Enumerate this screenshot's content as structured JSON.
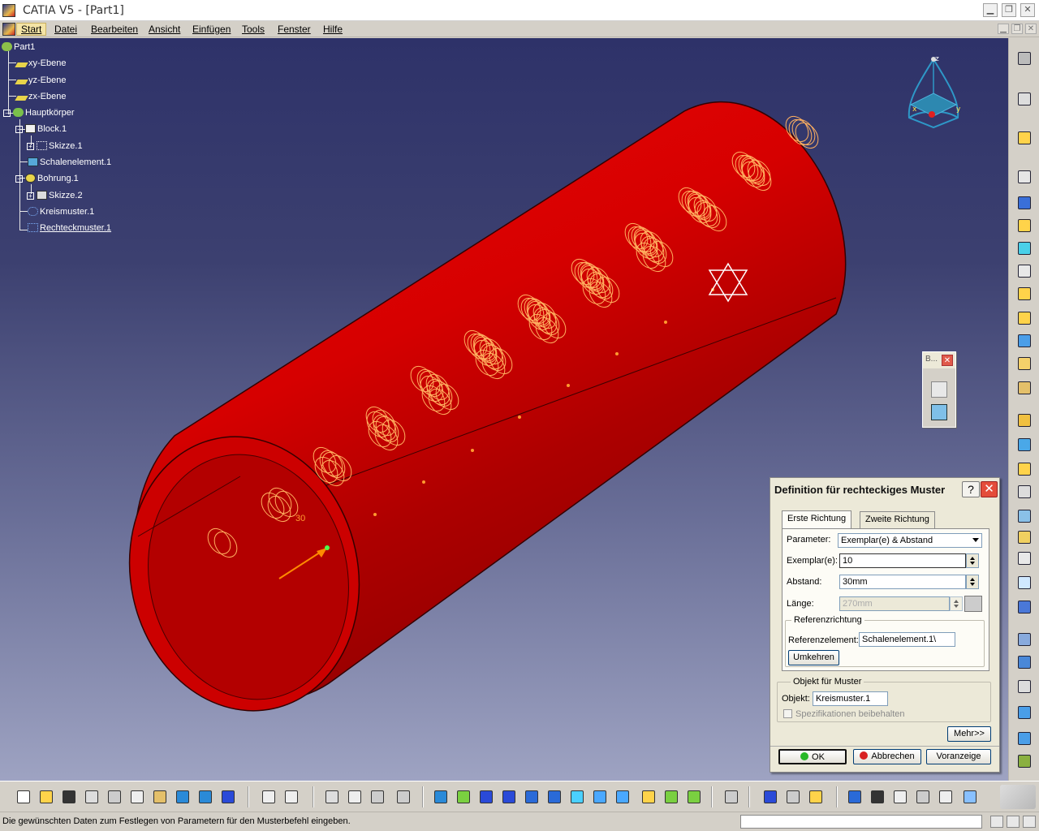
{
  "window": {
    "title": "CATIA V5 - [Part1]",
    "minimize_glyph": "▁",
    "restore_glyph": "❐",
    "close_glyph": "✕"
  },
  "menu": {
    "items": [
      "Start",
      "Datei",
      "Bearbeiten",
      "Ansicht",
      "Einfügen",
      "Tools",
      "Fenster",
      "Hilfe"
    ],
    "active": "Start"
  },
  "tree": {
    "root": "Part1",
    "items": [
      "xy-Ebene",
      "yz-Ebene",
      "zx-Ebene",
      "Hauptkörper",
      "Block.1",
      "Skizze.1",
      "Schalenelement.1",
      "Bohrung.1",
      "Skizze.2",
      "Kreismuster.1",
      "Rechteckmuster.1"
    ]
  },
  "viewport": {
    "compass_labels": {
      "z": "z",
      "x": "x",
      "y": "y"
    },
    "dimension_label": "30",
    "part_color": "#e00000"
  },
  "palette": {
    "title": "B...",
    "close_glyph": "✕"
  },
  "dialog": {
    "title": "Definition für rechteckiges Muster",
    "help_glyph": "?",
    "close_glyph": "✕",
    "tabs": [
      "Erste Richtung",
      "Zweite Richtung"
    ],
    "parameter_label": "Parameter:",
    "parameter_value": "Exemplar(e) & Abstand",
    "instances_label": "Exemplar(e):",
    "instances_value": "10",
    "spacing_label": "Abstand:",
    "spacing_value": "30mm",
    "length_label": "Länge:",
    "length_value": "270mm",
    "reference_group": "Referenzrichtung",
    "reference_label": "Referenzelement:",
    "reference_value": "Schalenelement.1\\",
    "reverse_button": "Umkehren",
    "object_group": "Objekt für Muster",
    "object_label": "Objekt:",
    "object_value": "Kreismuster.1",
    "keep_specs_label": "Spezifikationen beibehalten",
    "more_button": "Mehr>>",
    "ok_button": "OK",
    "cancel_button": "Abbrechen",
    "preview_button": "Voranzeige"
  },
  "status": {
    "message": "Die gewünschten Daten zum Festlegen von Parametern für den Musterbefehl eingeben."
  },
  "colors": {
    "background_top": "#2e3269",
    "background_bottom": "#9ea3c2",
    "part": "#e00000",
    "active_menu": "#f4e4a6"
  }
}
